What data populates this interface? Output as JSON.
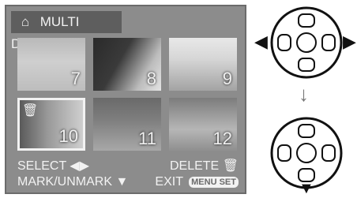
{
  "header": {
    "title": "MULTI DELETE",
    "icon": "multi-image-icon"
  },
  "thumbnails": [
    {
      "number": "7",
      "selected": false,
      "marked": false
    },
    {
      "number": "8",
      "selected": false,
      "marked": false
    },
    {
      "number": "9",
      "selected": false,
      "marked": false
    },
    {
      "number": "10",
      "selected": true,
      "marked": true
    },
    {
      "number": "11",
      "selected": false,
      "marked": false
    },
    {
      "number": "12",
      "selected": false,
      "marked": false
    }
  ],
  "footer": {
    "select_label": "SELECT",
    "delete_label": "DELETE",
    "mark_label": "MARK/UNMARK",
    "exit_label": "EXIT",
    "menu_label": "MENU",
    "set_label": "SET"
  },
  "controls": {
    "left_right_arrows": "◀ ▶",
    "down_arrow": "↓"
  }
}
